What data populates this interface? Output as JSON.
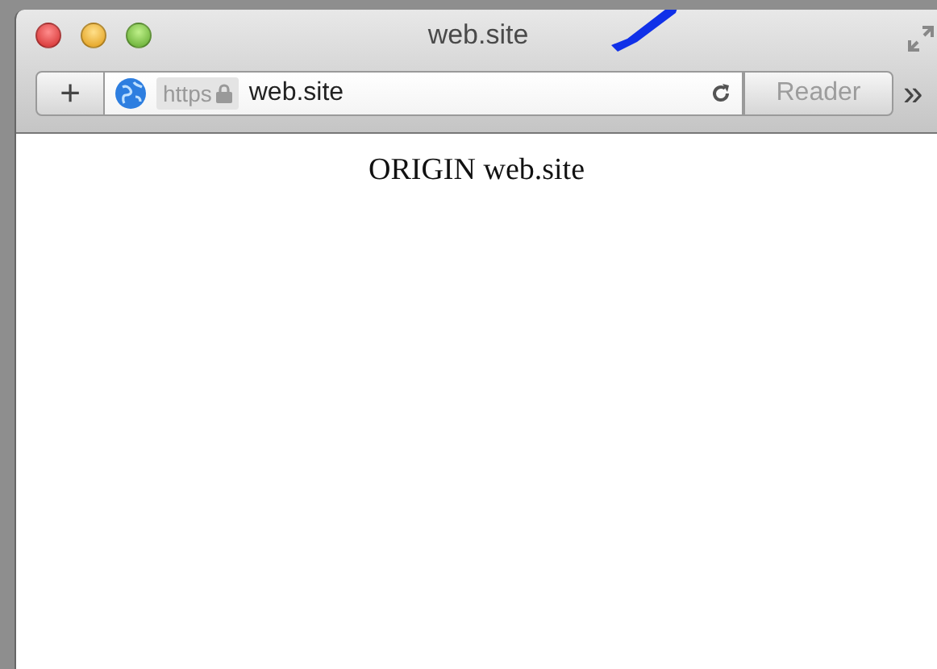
{
  "window": {
    "title": "web.site"
  },
  "toolbar": {
    "add_button": "+",
    "address": {
      "scheme": "https",
      "secure": true,
      "url": "web.site"
    },
    "reader_button": {
      "label": "Reader",
      "disabled": true
    },
    "overflow": "»"
  },
  "page": {
    "text": "ORIGIN web.site"
  }
}
